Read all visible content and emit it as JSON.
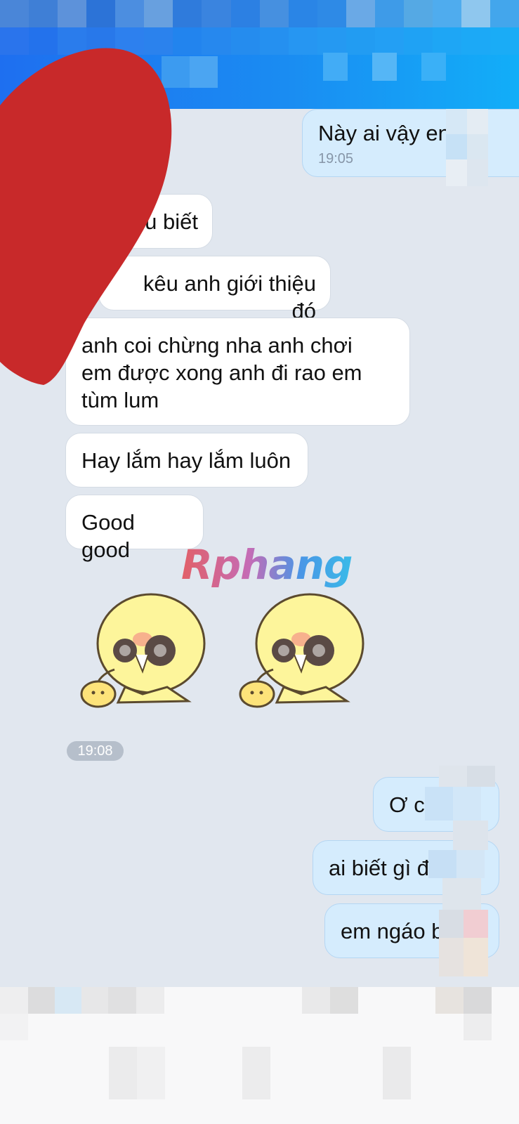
{
  "messages": {
    "sent_1": {
      "text": "Này ai vậy en",
      "time": "19:05"
    },
    "recv_1": "u biết",
    "recv_2": "kêu anh giới thiệu đó",
    "recv_3": "anh coi chừng nha anh chơi em được xong anh đi rao em tùm lum",
    "recv_4": "Hay lắm hay lắm luôn",
    "recv_5": "Good good",
    "sticker_time": "19:08",
    "sent_2": "Ơ c",
    "sent_3": "ai biết gì đ",
    "sent_4": "em ngáo b"
  },
  "watermark": "Rphang",
  "stickers": [
    {
      "icon": "chick-sticker-icon"
    },
    {
      "icon": "chick-sticker-icon"
    }
  ],
  "colors": {
    "header_blue": "#1a8cf2",
    "chat_background": "#e1e7ef",
    "sent_bubble": "#d5ecfd",
    "received_bubble": "#ffffff",
    "red_sticker_overlay": "#c8292a"
  }
}
